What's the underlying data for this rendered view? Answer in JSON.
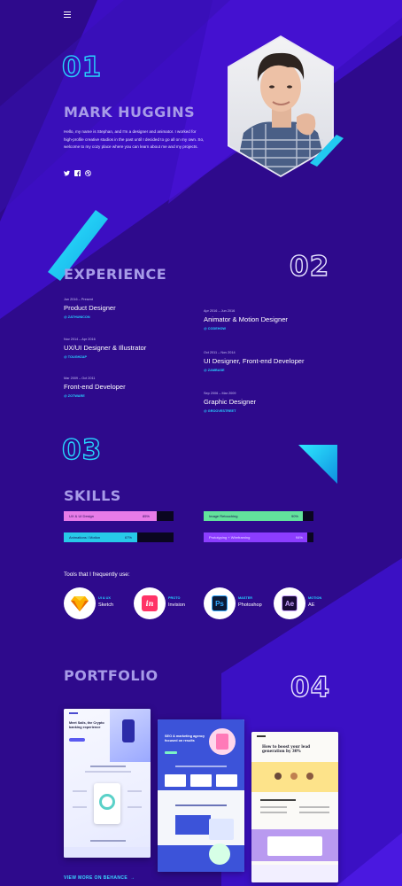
{
  "nav": {
    "menu_icon": "hamburger-menu-icon"
  },
  "hero": {
    "number": "01",
    "name": "MARK HUGGINS",
    "bio": "Hello, my name is Stephan, and I'm a designer and animator. I worked for high-profile creative studios in the past until I decided to go all on my own. So, welcome to my cozy place where you can learn about me and my projects.",
    "socials": [
      "twitter-icon",
      "facebook-icon",
      "dribbble-icon"
    ]
  },
  "experience": {
    "number": "02",
    "title": "EXPERIENCE",
    "left": [
      {
        "date": "Jun 2016 – Present",
        "role": "Product Designer",
        "company": "@ ZATHUNICON"
      },
      {
        "date": "Nov 2014 – Apr 2016",
        "role": "UX/UI Designer & Illustrator",
        "company": "@ TOUGHZAP"
      },
      {
        "date": "Mar 2009 – Oct 2011",
        "role": "Front-end Developer",
        "company": "@ ZOTWARE"
      }
    ],
    "right": [
      {
        "date": "Apr 2016 – Jun 2016",
        "role": "Animator & Motion Designer",
        "company": "@ CODEHOW"
      },
      {
        "date": "Oct 2011 – Nov 2014",
        "role": "UI Designer, Front-end Developer",
        "company": "@ ZAMBASE"
      },
      {
        "date": "Sep 2006 – Mar 2009",
        "role": "Graphic Designer",
        "company": "@ GROOVESTREET"
      }
    ]
  },
  "skills": {
    "number": "03",
    "title": "SKILLS",
    "bars": [
      {
        "label": "UX & UI Design",
        "value": "85%",
        "fraction": 0.85,
        "color": "#e77be8"
      },
      {
        "label": "Image Retouching",
        "value": "90%",
        "fraction": 0.9,
        "color": "#62e29c"
      },
      {
        "label": "Animations / Motion",
        "value": "67%",
        "fraction": 0.67,
        "color": "#27c9e8"
      },
      {
        "label": "Prototyping + Wireframing",
        "value": "94%",
        "fraction": 0.94,
        "color": "#8c3dff"
      }
    ],
    "tools_heading": "Tools that I frequently use:",
    "tools": [
      {
        "category": "UI & UX",
        "name": "Sketch",
        "icon": "sketch-icon"
      },
      {
        "category": "PROTO",
        "name": "Invision",
        "icon": "invision-icon",
        "glyph": "in"
      },
      {
        "category": "MASTER",
        "name": "Photoshop",
        "icon": "photoshop-icon",
        "glyph": "Ps"
      },
      {
        "category": "MOTION",
        "name": "AE",
        "icon": "after-effects-icon",
        "glyph": "Ae"
      }
    ]
  },
  "portfolio": {
    "number": "04",
    "title": "PORTFOLIO",
    "link": "VIEW MORE ON BEHANCE",
    "shot1_title": "Meet Sails, the Crypto banking experience",
    "shot2_title": "SEO & marketing agency focused on results",
    "shot3_title": "How to boost your lead generation by 30%"
  }
}
